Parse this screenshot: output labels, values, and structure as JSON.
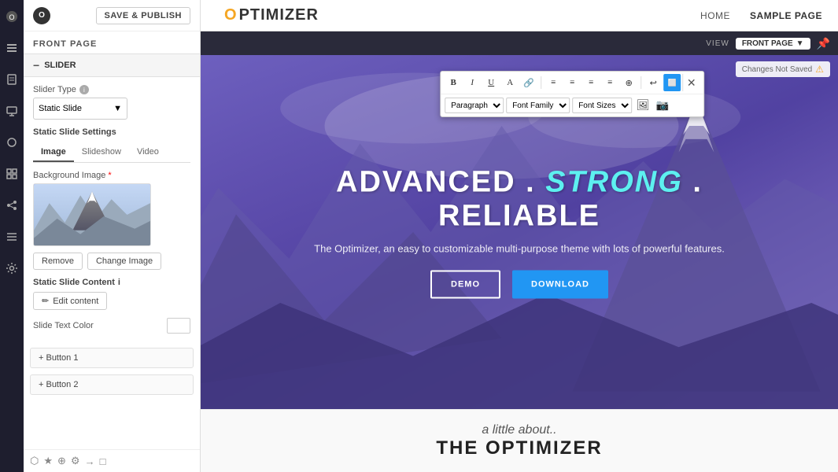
{
  "app": {
    "logo_letter": "O",
    "logo_rest": "PTIMIZER"
  },
  "topbar": {
    "save_publish_label": "SAVE & PUBLISH",
    "panel_title": "FRONT PAGE",
    "view_label": "VIEW",
    "view_page_label": "FRONT PAGE"
  },
  "nav": {
    "home": "HOME",
    "sample_page": "SAMPLE PAGE"
  },
  "sidebar": {
    "section_label": "SLIDER",
    "slider_type_label": "Slider Type",
    "slider_type_value": "Static Slide",
    "static_slide_settings": "Static Slide Settings",
    "tabs": [
      {
        "label": "Image",
        "active": true
      },
      {
        "label": "Slideshow",
        "active": false
      },
      {
        "label": "Video",
        "active": false
      }
    ],
    "bg_image_label": "Background Image",
    "bg_image_required": "*",
    "remove_btn": "Remove",
    "change_image_btn": "Change Image",
    "static_content_label": "Static Slide Content",
    "edit_content_btn": "Edit content",
    "slide_text_color_label": "Slide Text Color",
    "button1_label": "+ Button 1",
    "button2_label": "+ Button 2"
  },
  "toolbar": {
    "row1_buttons": [
      "B",
      "I",
      "U",
      "A",
      "⊞",
      "≡",
      "≡",
      "≡",
      "⊕",
      "↩"
    ],
    "row2_selects": [
      "Paragraph",
      "Font Family",
      "Font Sizes"
    ],
    "expand_icon": "⬜",
    "close_icon": "✕"
  },
  "hero": {
    "title_part1": "ADVANCED . ",
    "title_strong": "STRONG",
    "title_part2": " . RELIABLE",
    "subtitle": "The Optimizer, an easy to customizable multi-purpose theme with lots of powerful features.",
    "btn_demo": "DEMO",
    "btn_download": "DOWNLOAD",
    "changes_badge": "Changes Not Saved"
  },
  "bottom_preview": {
    "about_text": "a little about..",
    "title_text": "THE OPTIMIZER"
  },
  "footer_icons": [
    "⬡",
    "★",
    "⊕",
    "⚙",
    "→",
    "□"
  ]
}
